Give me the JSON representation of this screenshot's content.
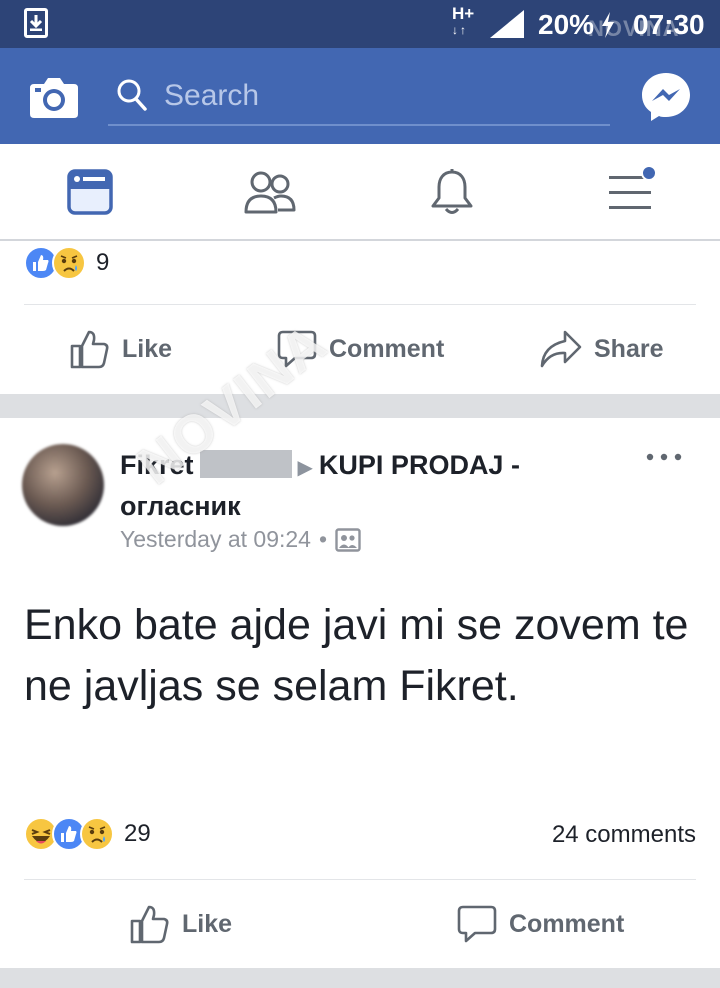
{
  "status_bar": {
    "network": "H+",
    "battery": "20%",
    "time": "07:30",
    "watermark": "NOVINA"
  },
  "header": {
    "search": {
      "placeholder": "Search"
    }
  },
  "tabs": [
    {
      "name": "news-feed",
      "icon": "news-feed-icon",
      "active": true
    },
    {
      "name": "friends",
      "icon": "friends-icon",
      "active": false
    },
    {
      "name": "notifications",
      "icon": "bell-icon",
      "active": false
    },
    {
      "name": "menu",
      "icon": "hamburger-icon",
      "active": false,
      "badge": true
    }
  ],
  "post_1": {
    "reactions": [
      "like",
      "sad"
    ],
    "reaction_count": "9",
    "actions": {
      "like": "Like",
      "comment": "Comment",
      "share": "Share"
    }
  },
  "post_2": {
    "author": "Fikret",
    "group": "KUPI PRODAJ - огласник",
    "time": "Yesterday at 09:24",
    "privacy_icon": "group-photo-icon",
    "body": "Enko bate ajde javi mi se zovem te ne javljas se selam Fikret.",
    "reactions": [
      "haha",
      "like",
      "sad"
    ],
    "reaction_count": "29",
    "comments_count": "24 comments",
    "actions": {
      "like": "Like",
      "comment": "Comment"
    },
    "watermark": "NOVINA"
  },
  "colors": {
    "status_bar": "#2d4477",
    "header": "#4267b2",
    "active_tab": "#4267b2",
    "like_blue": "#4c87f5",
    "emoji_yellow": "#f7c641",
    "muted_text": "#606770"
  }
}
